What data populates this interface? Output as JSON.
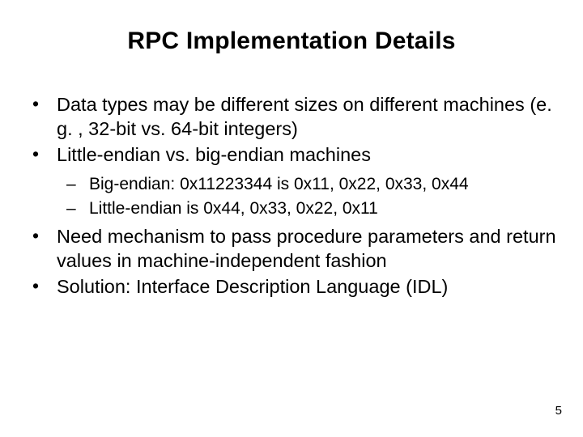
{
  "title": "RPC Implementation Details",
  "bullets": {
    "b1": "Data types may be different sizes on different machines (e. g. , 32-bit vs. 64-bit integers)",
    "b2": "Little-endian vs. big-endian machines",
    "b2a": "Big-endian: 0x11223344 is 0x11, 0x22, 0x33, 0x44",
    "b2b": "Little-endian is 0x44, 0x33, 0x22, 0x11",
    "b3": "Need mechanism to pass procedure parameters and return values in machine-independent fashion",
    "b4": "Solution: Interface Description Language (IDL)"
  },
  "pagenum": "5"
}
